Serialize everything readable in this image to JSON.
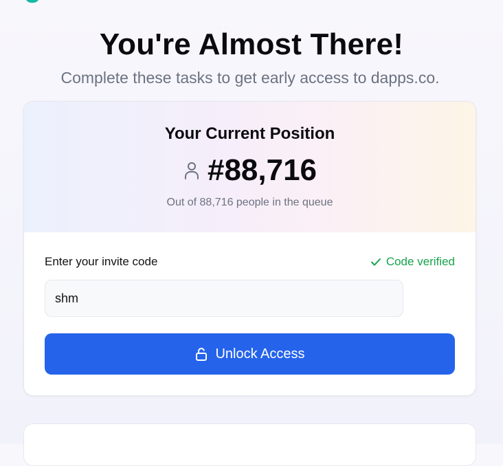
{
  "header": {
    "title": "You're Almost There!",
    "subtitle": "Complete these tasks to get early access to dapps.co."
  },
  "position_card": {
    "heading": "Your Current Position",
    "icon": "user-icon",
    "rank": "#88,716",
    "queue_note": "Out of 88,716 people in the queue"
  },
  "invite": {
    "label": "Enter your invite code",
    "status_icon": "check-icon",
    "status_text": "Code verified",
    "input_value": "shm",
    "button_icon": "lock-icon",
    "button_label": "Unlock Access"
  },
  "colors": {
    "primary": "#2563eb",
    "success": "#16a34a",
    "muted_text": "#6b7280",
    "logo_accent": "#14b8a6"
  }
}
